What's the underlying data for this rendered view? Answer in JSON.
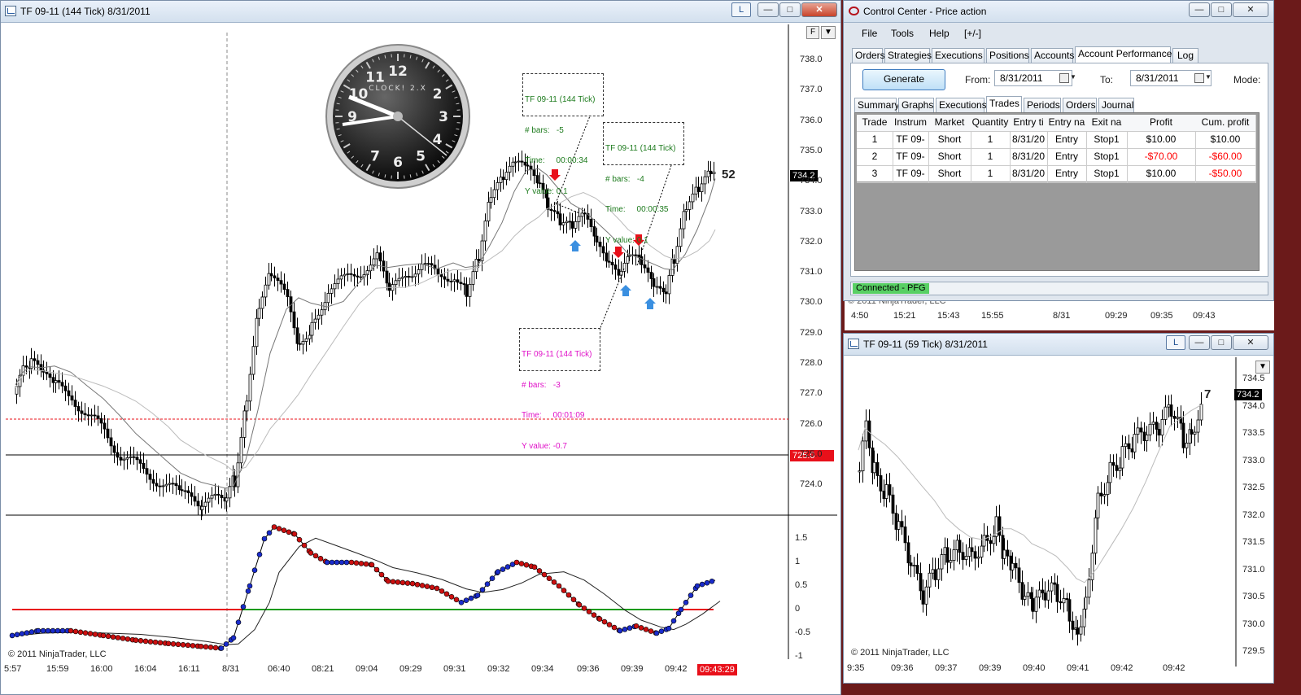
{
  "main_window": {
    "title": "TF 09-11 (144 Tick)  8/31/2011",
    "link_label": "L",
    "f_label": "F",
    "bar_counter": "52",
    "last_price": "734.2",
    "hline_price": "725.0",
    "y_ticks": [
      "738.0",
      "737.0",
      "736.0",
      "735.0",
      "734.0",
      "733.0",
      "732.0",
      "731.0",
      "730.0",
      "729.0",
      "728.0",
      "727.0",
      "726.0",
      "725.0",
      "724.0"
    ],
    "indicator_ticks": [
      "1.5",
      "1",
      "0.5",
      "0",
      "-0.5",
      "-1"
    ],
    "x_ticks": [
      "5:57",
      "15:59",
      "16:00",
      "16:04",
      "16:11",
      "8/31",
      "06:40",
      "08:21",
      "09:04",
      "09:29",
      "09:31",
      "09:32",
      "09:34",
      "09:36",
      "09:39",
      "09:42"
    ],
    "time_box": "09:43:29",
    "copyright": "© 2011 NinjaTrader, LLC",
    "clock_brand": "CLOCK! 2.X",
    "clock_numbers": [
      "12",
      "2",
      "3",
      "4",
      "5",
      "6",
      "7",
      "9",
      "10",
      "11"
    ],
    "annotations": [
      {
        "title": "TF 09-11 (144 Tick)",
        "bars": "# bars:   -5",
        "time": "Time:     00:00:34",
        "yval": "Y value: 0.1"
      },
      {
        "title": "TF 09-11 (144 Tick)",
        "bars": "# bars:   -4",
        "time": "Time:     00:00:35",
        "yval": "Y value: 0.1"
      },
      {
        "title": "TF 09-11 (144 Tick)",
        "bars": "# bars:   -3",
        "time": "Time:     00:01:09",
        "yval": "Y value: -0.7"
      }
    ]
  },
  "control_center": {
    "title": "Control Center - Price action",
    "menu": [
      "File",
      "Tools",
      "Help",
      "[+/-]"
    ],
    "tabs": [
      "Orders",
      "Strategies",
      "Executions",
      "Positions",
      "Accounts",
      "Account Performance",
      "Log"
    ],
    "generate_label": "Generate",
    "from_label": "From:",
    "from_value": "8/31/2011",
    "to_label": "To:",
    "to_value": "8/31/2011",
    "mode_label": "Mode:",
    "subtabs": [
      "Summary",
      "Graphs",
      "Executions",
      "Trades",
      "Periods",
      "Orders",
      "Journal"
    ],
    "columns": [
      "Trade",
      "Instrum",
      "Market",
      "Quantity",
      "Entry ti",
      "Entry na",
      "Exit na",
      "Profit",
      "Cum. profit"
    ],
    "rows": [
      [
        "1",
        "TF 09-",
        "Short",
        "1",
        "8/31/20",
        "Entry",
        "Stop1",
        "$10.00",
        "$10.00"
      ],
      [
        "2",
        "TF 09-",
        "Short",
        "1",
        "8/31/20",
        "Entry",
        "Stop1",
        "-$70.00",
        "-$60.00"
      ],
      [
        "3",
        "TF 09-",
        "Short",
        "1",
        "8/31/20",
        "Entry",
        "Stop1",
        "$10.00",
        "-$50.00"
      ]
    ],
    "status": "Connected - PFG"
  },
  "behind_axis": {
    "ticks": [
      "4:50",
      "15:21",
      "15:43",
      "15:55",
      "8/31",
      "09:29",
      "09:35",
      "09:43"
    ],
    "copyright_partial": "© 2011 NinjaTrader, LLC"
  },
  "second_window": {
    "title": "TF 09-11 (59 Tick)  8/31/2011",
    "link_label": "L",
    "bar_counter": "7",
    "last_price": "734.2",
    "y_ticks": [
      "734.5",
      "734.0",
      "733.5",
      "733.0",
      "732.5",
      "732.0",
      "731.5",
      "731.0",
      "730.5",
      "730.0",
      "729.5"
    ],
    "x_ticks": [
      "9:35",
      "09:36",
      "09:37",
      "09:39",
      "09:40",
      "09:41",
      "09:42",
      "09:42"
    ],
    "copyright": "© 2011 NinjaTrader, LLC"
  },
  "colors": {
    "up": "#ffffff",
    "down": "#000000",
    "loss": "#ff0000",
    "dot_red": "#cc1010",
    "dot_blue": "#1a2ccc"
  }
}
